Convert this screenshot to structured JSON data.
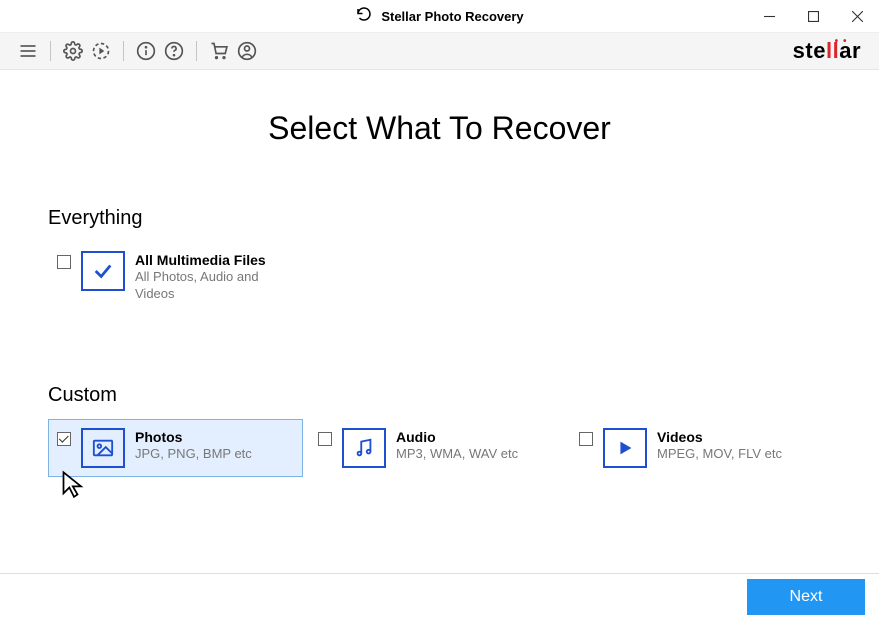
{
  "window": {
    "title": "Stellar Photo Recovery"
  },
  "brand": {
    "name_pre": "ste",
    "name_accent": "ll",
    "name_post": "ar"
  },
  "page": {
    "title": "Select What To Recover"
  },
  "everything": {
    "header": "Everything",
    "item": {
      "title": "All Multimedia Files",
      "sub": "All Photos, Audio and Videos",
      "checked": false
    }
  },
  "custom": {
    "header": "Custom",
    "items": [
      {
        "key": "photos",
        "title": "Photos",
        "sub": "JPG, PNG, BMP etc",
        "checked": true,
        "selected": true
      },
      {
        "key": "audio",
        "title": "Audio",
        "sub": "MP3, WMA, WAV etc",
        "checked": false,
        "selected": false
      },
      {
        "key": "videos",
        "title": "Videos",
        "sub": "MPEG, MOV, FLV etc",
        "checked": false,
        "selected": false
      }
    ]
  },
  "footer": {
    "next": "Next"
  }
}
